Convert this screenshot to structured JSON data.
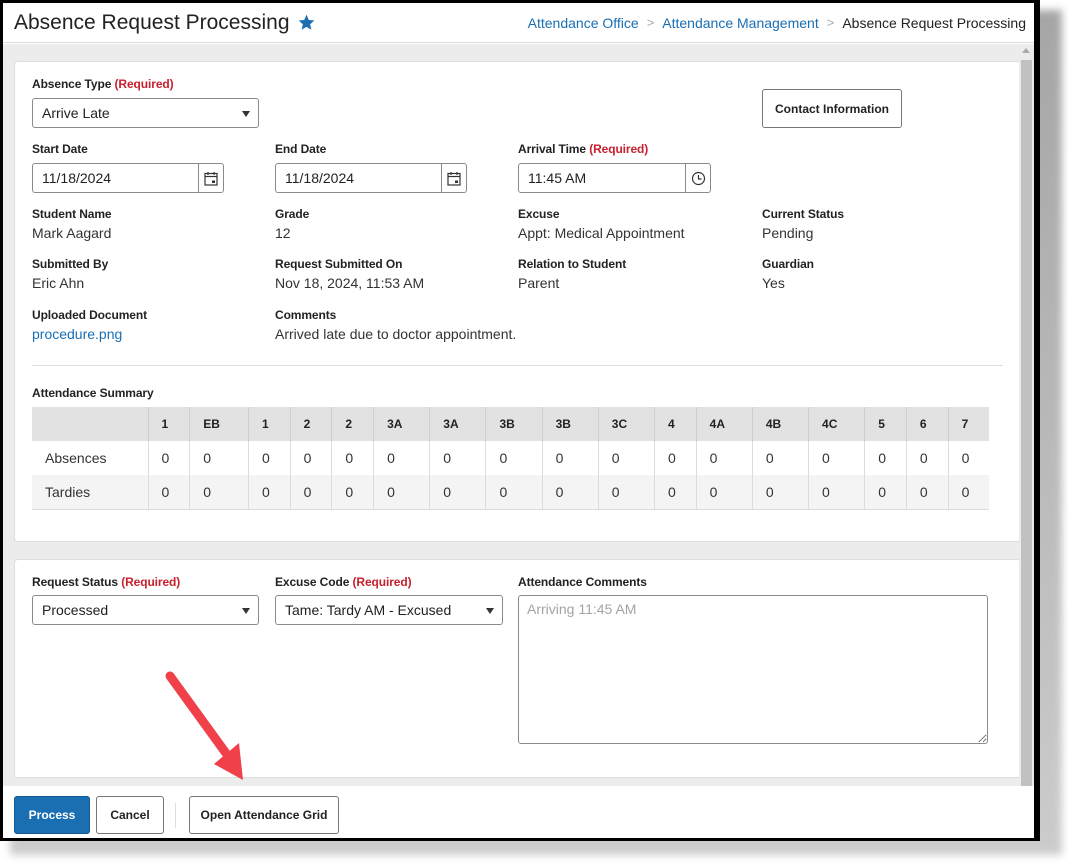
{
  "header": {
    "title": "Absence Request Processing",
    "favorite_icon": "star-icon",
    "breadcrumb": [
      {
        "label": "Attendance Office",
        "link": true
      },
      {
        "label": "Attendance Management",
        "link": true
      },
      {
        "label": "Absence Request Processing",
        "link": false
      }
    ],
    "separator": ">"
  },
  "colors": {
    "accent": "#1a6fb3",
    "required": "#c8202f",
    "annotation_arrow": "#f0404a"
  },
  "form": {
    "required_tag": "(Required)",
    "absence_type": {
      "label": "Absence Type",
      "value": "Arrive Late"
    },
    "contact_button": "Contact Information",
    "start_date": {
      "label": "Start Date",
      "value": "11/18/2024",
      "icon": "calendar-icon"
    },
    "end_date": {
      "label": "End Date",
      "value": "11/18/2024",
      "icon": "calendar-icon"
    },
    "arrival_time": {
      "label": "Arrival Time",
      "value": "11:45 AM",
      "icon": "clock-icon"
    },
    "details": [
      {
        "label": "Student Name",
        "value": "Mark Aagard"
      },
      {
        "label": "Grade",
        "value": "12"
      },
      {
        "label": "Excuse",
        "value": "Appt: Medical Appointment"
      },
      {
        "label": "Current Status",
        "value": "Pending"
      },
      {
        "label": "Submitted By",
        "value": "Eric Ahn"
      },
      {
        "label": "Request Submitted On",
        "value": "Nov 18, 2024, 11:53 AM"
      },
      {
        "label": "Relation to Student",
        "value": "Parent"
      },
      {
        "label": "Guardian",
        "value": "Yes"
      },
      {
        "label": "Uploaded Document",
        "value": "procedure.png"
      },
      {
        "label": "Comments",
        "value": "Arrived late due to doctor appointment."
      }
    ]
  },
  "attendance_summary": {
    "title": "Attendance Summary",
    "columns": [
      "",
      "1",
      "EB",
      "1",
      "2",
      "2",
      "3A",
      "3A",
      "3B",
      "3B",
      "3C",
      "4",
      "4A",
      "4B",
      "4C",
      "5",
      "6",
      "7"
    ],
    "rows": [
      {
        "label": "Absences",
        "values": [
          "0",
          "0",
          "0",
          "0",
          "0",
          "0",
          "0",
          "0",
          "0",
          "0",
          "0",
          "0",
          "0",
          "0",
          "0",
          "0",
          "0"
        ]
      },
      {
        "label": "Tardies",
        "values": [
          "0",
          "0",
          "0",
          "0",
          "0",
          "0",
          "0",
          "0",
          "0",
          "0",
          "0",
          "0",
          "0",
          "0",
          "0",
          "0",
          "0"
        ]
      }
    ]
  },
  "processing": {
    "request_status": {
      "label": "Request Status",
      "value": "Processed"
    },
    "excuse_code": {
      "label": "Excuse Code",
      "value": "Tame: Tardy AM - Excused"
    },
    "attendance_comments": {
      "label": "Attendance Comments",
      "placeholder": "Arriving 11:45 AM",
      "value": ""
    }
  },
  "footer": {
    "process": "Process",
    "cancel": "Cancel",
    "open_grid": "Open Attendance Grid"
  }
}
